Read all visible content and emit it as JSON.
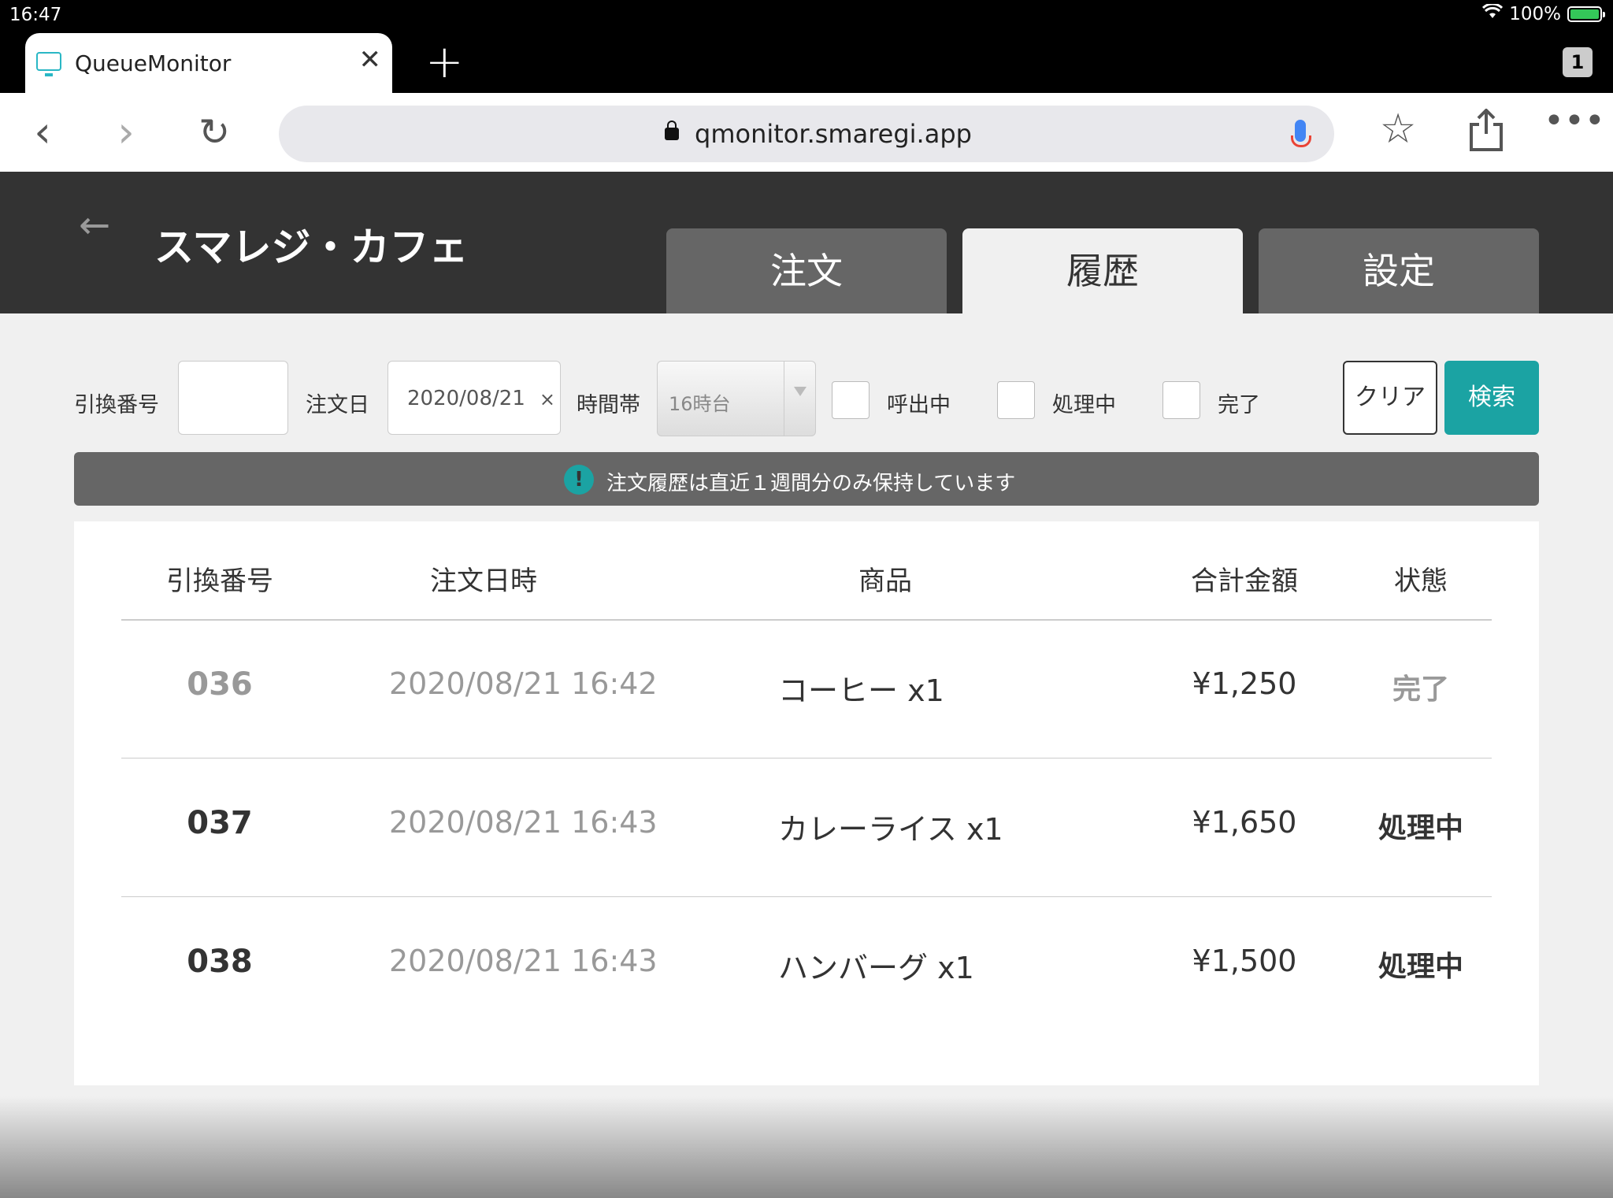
{
  "status_bar": {
    "time": "16:47",
    "battery": "100%"
  },
  "browser": {
    "tab_title": "QueueMonitor",
    "tab_count": "1",
    "url": "qmonitor.smaregi.app"
  },
  "app": {
    "shop_name": "スマレジ・カフェ",
    "tabs": [
      {
        "label": "注文"
      },
      {
        "label": "履歴"
      },
      {
        "label": "設定"
      }
    ]
  },
  "filter": {
    "exchange_no_label": "引換番号",
    "exchange_no_value": "",
    "order_date_label": "注文日",
    "order_date_value": "2020/08/21",
    "time_slot_label": "時間帯",
    "time_slot_value": "16時台",
    "checkboxes": [
      {
        "label": "呼出中",
        "checked": false
      },
      {
        "label": "処理中",
        "checked": false
      },
      {
        "label": "完了",
        "checked": false
      }
    ],
    "clear_label": "クリア",
    "search_label": "検索"
  },
  "notice": {
    "message": "注文履歴は直近１週間分のみ保持しています"
  },
  "table": {
    "headers": [
      "引換番号",
      "注文日時",
      "商品",
      "合計金額",
      "状態"
    ],
    "rows": [
      {
        "number": "036",
        "datetime": "2020/08/21  16:42",
        "item": "コーヒー x1",
        "total": "¥1,250",
        "status": "完了"
      },
      {
        "number": "037",
        "datetime": "2020/08/21  16:43",
        "item": "カレーライス x1",
        "total": "¥1,650",
        "status": "処理中"
      },
      {
        "number": "038",
        "datetime": "2020/08/21  16:43",
        "item": "ハンバーグ x1",
        "total": "¥1,500",
        "status": "処理中"
      }
    ]
  },
  "colors": {
    "header_bg": "#333333",
    "accent": "#1ba3a3",
    "completed_text": "#999999",
    "processing_text": "#333333"
  }
}
